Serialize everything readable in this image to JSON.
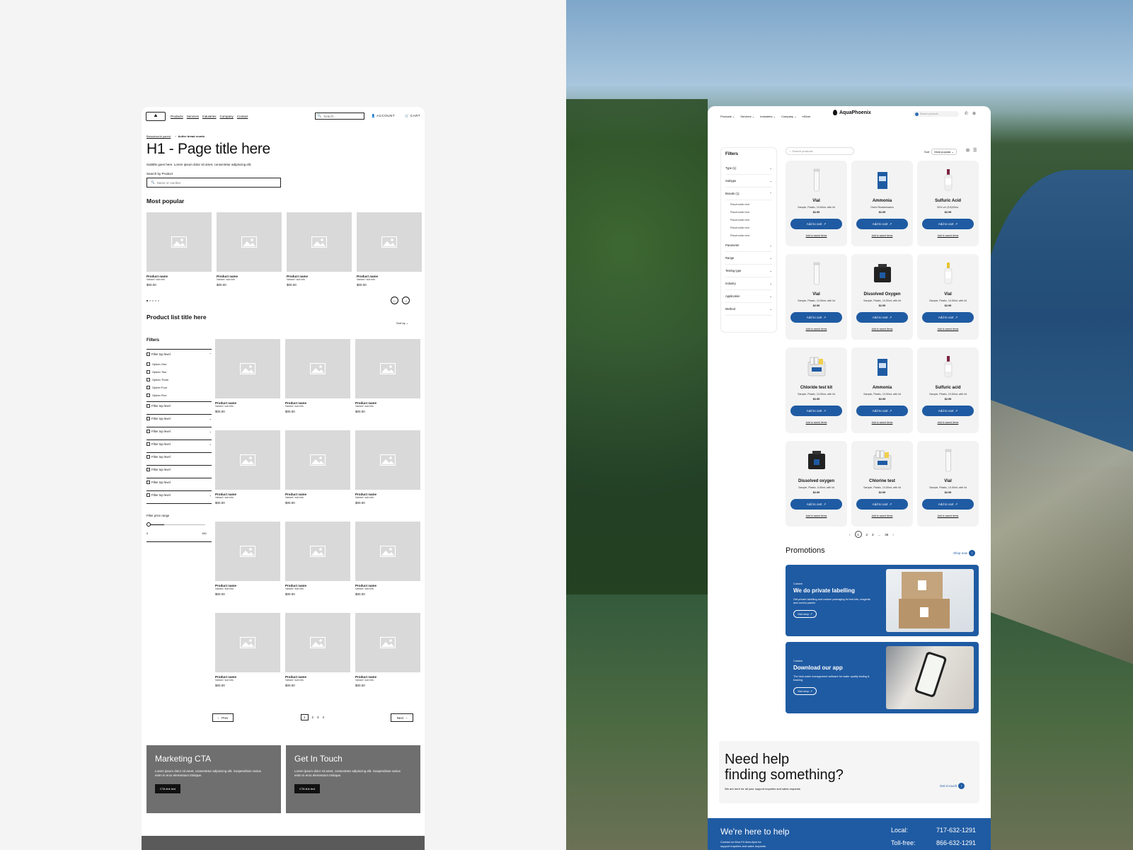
{
  "wireframe": {
    "logo_glyph": "⛰",
    "nav": [
      "Products",
      "Services",
      "Industries",
      "Company",
      "Contact"
    ],
    "search_placeholder": "Search...",
    "account": "ACCOUNT",
    "cart": "CART",
    "breadcrumb_parent": "Breadcrumb parent",
    "breadcrumb_active": "Active bread crumb",
    "title": "H1 - Page title here",
    "subtitle": "Subtitle goes here. Lorem ipsum dolor sit amet, consectetur adipiscing elit.",
    "search_label": "Search by Product",
    "search_field_placeholder": "Name or number",
    "most_popular": "Most popular",
    "product": {
      "name": "Product name",
      "variant": "Variant / sub info",
      "price": "$00.00"
    },
    "product_list_title": "Product list title here",
    "sort_by": "Sort by",
    "filters_title": "Filters",
    "filter_top_level": "Filter top level",
    "options": [
      "Option One",
      "Option Two",
      "Option Three",
      "Option Four",
      "Option Five"
    ],
    "filter_price_range": "Filter price range",
    "range_min": "0",
    "range_max": "150",
    "prev": "Prev",
    "next": "Next",
    "pages": [
      "1",
      "2",
      "3",
      "4"
    ],
    "cta1": {
      "title": "Marketing CTA",
      "body": "Lorem ipsum dolor sit amet, consectetur adipiscing elit. Suspendisse varius enim in eros elementum tristique.",
      "button": "CTA link text"
    },
    "cta2": {
      "title": "Get In Touch",
      "body": "Lorem ipsum dolor sit amet, consectetur adipiscing elit. Suspendisse varius enim in eros elementum tristique.",
      "button": "CTA link text"
    }
  },
  "site": {
    "nav": [
      "Products",
      "Services",
      "Industries",
      "Company",
      "eStore"
    ],
    "logo": "AquaPhoenix",
    "search_placeholder": "Search products",
    "filters_title": "Filters",
    "filters": [
      "Type (1)",
      "Subtype",
      "Brands (1)"
    ],
    "brand_subitems": [
      "Placeholder text",
      "Placeholder text",
      "Placeholder text",
      "Placeholder text",
      "Placeholder text"
    ],
    "filters2": [
      "Parameter",
      "Range",
      "Testing type",
      "Industry",
      "Application",
      "Method"
    ],
    "product_search_placeholder": "Search products",
    "sort_label": "Sort",
    "sort_value": "Most popular",
    "add_to_cart": "Add to cart",
    "add_to_saved": "Add to saved items",
    "products": [
      {
        "name": "Vial",
        "desc": "Sample, Plastic, 10-60mL with lid",
        "price": "$2.99",
        "img": "vial"
      },
      {
        "name": "Ammonia",
        "desc": "Direct Readerisation",
        "price": "$2.99",
        "img": "box-blue"
      },
      {
        "name": "Sulfuric Acid",
        "desc": "50% v/v (9.8)30mL",
        "price": "$2.99",
        "img": "dropper-red"
      },
      {
        "name": "Vial",
        "desc": "Sample, Plastic, 10-50mL with lid",
        "price": "$2.99",
        "img": "vial"
      },
      {
        "name": "Dissolved Oxygen",
        "desc": "Sample, Plastic, 10-50mL with lid",
        "price": "$2.99",
        "img": "kit-dark"
      },
      {
        "name": "Vial",
        "desc": "Sample, Plastic, 10-50mL with lid",
        "price": "$2.99",
        "img": "dropper-yellow"
      },
      {
        "name": "Chloride test kit",
        "desc": "Sample, Plastic, 10-50mL with lid",
        "price": "$2.99",
        "img": "kit-light"
      },
      {
        "name": "Ammonia",
        "desc": "Sample, Plastic, 10-50mL with lid",
        "price": "$2.99",
        "img": "box-blue"
      },
      {
        "name": "Sulfuric acid",
        "desc": "Sample, Plastic, 10-50mL with lid",
        "price": "$2.99",
        "img": "dropper-red"
      },
      {
        "name": "Dissolved oxygen",
        "desc": "Sample, Plastic, 5-50mL with lid",
        "price": "$2.99",
        "img": "kit-dark"
      },
      {
        "name": "Chlorine test",
        "desc": "Sample, Plastic, 10-50mL with lid",
        "price": "$2.99",
        "img": "kit-light"
      },
      {
        "name": "Vial",
        "desc": "Sample, Plastic, 10-50mL with lid",
        "price": "$2.99",
        "img": "vial"
      }
    ],
    "pages": [
      "1",
      "2",
      "3",
      "...",
      "36"
    ],
    "promotions_title": "Promotions",
    "shop_now": "Shop now",
    "promo1": {
      "tag": "Custom",
      "title": "We do private labelling",
      "body": "Get private labelling and custom packaging for test kits, reagents and control panels",
      "button": "Visit shop"
    },
    "promo2": {
      "tag": "Custom",
      "title": "Download our app",
      "body": "The best water management software for water quality testing & tracking",
      "button": "Visit shop"
    },
    "help_title_1": "Need help",
    "help_title_2": "finding something?",
    "help_sub": "We are here for all your support inquiries and sales requests",
    "get_in_touch": "Get in touch",
    "footer_title": "We're here to help",
    "footer_sub": "Contact us Mon-Fri 8am-6pm for support inquiries and sales requests",
    "local_label": "Local:",
    "local_num": "717-632-1291",
    "tollfree_label": "Toll-free:",
    "tollfree_num": "866-632-1291",
    "brand_blue": "#1f5ba3"
  }
}
